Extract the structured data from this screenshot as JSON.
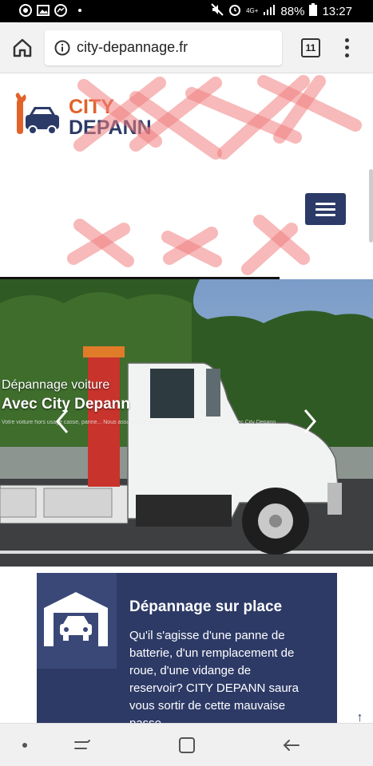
{
  "status_bar": {
    "battery_percent": "88%",
    "time": "13:27",
    "network": "4G+",
    "icons": [
      "chrome-icon",
      "image-icon",
      "messenger-icon",
      "dot-icon",
      "mute-icon",
      "alarm-icon",
      "signal-icon",
      "battery-icon"
    ]
  },
  "browser": {
    "url": "city-depannage.fr",
    "tab_count": "11",
    "icons": [
      "home-icon",
      "info-icon",
      "tabs-icon",
      "more-vert-icon"
    ]
  },
  "site": {
    "logo_line1": "CITY",
    "logo_line2": "DEPANN",
    "colors": {
      "brand_orange": "#e2622a",
      "brand_navy": "#2b3a67",
      "card_bg": "#2d3a66"
    }
  },
  "hero": {
    "subtitle": "Dépannage voiture",
    "title": "Avec City Depann",
    "description": "Votre voiture hors usage casse, panne... Nous assurons le dépannage rapide, 24h/24 et 7j/7 avec City Depann",
    "prev_icon": "chevron-left-icon",
    "next_icon": "chevron-right-icon"
  },
  "service_card": {
    "heading": "Dépannage sur place",
    "text": "Qu'il s'agisse d'une panne de batterie, d'un remplacement de roue, d'une vidange de reservoir? CITY DEPANN saura vous sortir de cette mauvaise passe",
    "icon": "garage-car-icon"
  },
  "scroll_top": "↑",
  "nav": {
    "icons": [
      "dot-icon",
      "recent-apps-icon",
      "home-square-icon",
      "back-arrow-icon"
    ]
  }
}
